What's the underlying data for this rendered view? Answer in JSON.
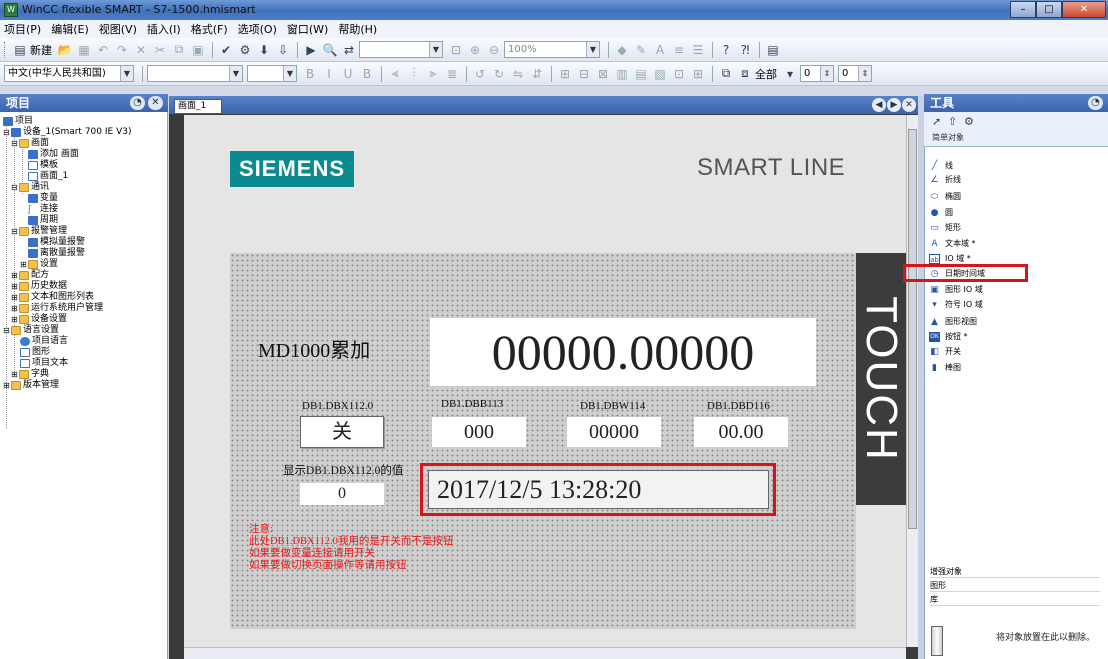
{
  "window": {
    "title": "WinCC flexible SMART - S7-1500.hmismart",
    "minimize": "–",
    "maximize": "□",
    "close": "✕"
  },
  "menu": [
    "项目(P)",
    "编辑(E)",
    "视图(V)",
    "插入(I)",
    "格式(F)",
    "选项(O)",
    "窗口(W)",
    "帮助(H)"
  ],
  "toolbar": {
    "new_label": "新建",
    "zoom_value": "100%",
    "all_label": "全部",
    "spin1": "0",
    "spin2": "0"
  },
  "language_combo": "中文(中华人民共和国)",
  "project_pane": {
    "title": "项目",
    "tree": [
      {
        "label": "项目",
        "level": 0
      },
      {
        "label": "设备_1(Smart 700 IE V3)",
        "level": 1
      },
      {
        "label": "画面",
        "level": 2
      },
      {
        "label": "添加 画面",
        "level": 3
      },
      {
        "label": "模板",
        "level": 3
      },
      {
        "label": "画面_1",
        "level": 3
      },
      {
        "label": "通讯",
        "level": 2
      },
      {
        "label": "变量",
        "level": 3
      },
      {
        "label": "连接",
        "level": 3
      },
      {
        "label": "周期",
        "level": 3
      },
      {
        "label": "报警管理",
        "level": 2
      },
      {
        "label": "模拟量报警",
        "level": 3
      },
      {
        "label": "离散量报警",
        "level": 3
      },
      {
        "label": "设置",
        "level": 3
      },
      {
        "label": "配方",
        "level": 2
      },
      {
        "label": "历史数据",
        "level": 2
      },
      {
        "label": "文本和图形列表",
        "level": 2
      },
      {
        "label": "运行系统用户管理",
        "level": 2
      },
      {
        "label": "设备设置",
        "level": 2
      },
      {
        "label": "语言设置",
        "level": 1
      },
      {
        "label": "项目语言",
        "level": 2
      },
      {
        "label": "图形",
        "level": 2
      },
      {
        "label": "项目文本",
        "level": 2
      },
      {
        "label": "字典",
        "level": 2
      },
      {
        "label": "版本管理",
        "level": 1
      }
    ]
  },
  "editor": {
    "tab": "画面_1",
    "logo": "SIEMENS",
    "brand_line": "SMART LINE",
    "touch": "TOUCH",
    "md_label": "MD1000累加",
    "md_value": "00000.00000",
    "fields": [
      {
        "label": "DB1.DBX112.0",
        "value": "关"
      },
      {
        "label": "DB1.DBB113",
        "value": "000"
      },
      {
        "label": "DB1.DBW114",
        "value": "00000"
      },
      {
        "label": "DB1.DBD116",
        "value": "00.00"
      }
    ],
    "show_label": "显示DB1.DBX112.0的值",
    "show_value": "0",
    "datetime": "2017/12/5 13:28:20",
    "notes": [
      "注意:",
      "此处DB1.DBX112.0我用的是开关而不是按钮",
      "如果要做变量连接请用开关",
      "如果要做切换页面操作等请用按钮"
    ]
  },
  "tools_pane": {
    "title": "工具",
    "section": "简单对象",
    "items": [
      {
        "label": "线",
        "icon": "line-icon",
        "glyph": "╱"
      },
      {
        "label": "折线",
        "icon": "polyline-icon",
        "glyph": "∠"
      },
      {
        "label": "椭圆",
        "icon": "ellipse-icon",
        "glyph": "⬭"
      },
      {
        "label": "圆",
        "icon": "circle-icon",
        "glyph": "●"
      },
      {
        "label": "矩形",
        "icon": "rectangle-icon",
        "glyph": "▭"
      },
      {
        "label": "文本域 *",
        "icon": "text-field-icon",
        "glyph": "A"
      },
      {
        "label": "IO 域 *",
        "icon": "io-field-icon",
        "glyph": "ab"
      },
      {
        "label": "日期时间域",
        "icon": "datetime-field-icon",
        "glyph": "◷"
      },
      {
        "label": "图形 IO 域",
        "icon": "graphic-io-icon",
        "glyph": "▣"
      },
      {
        "label": "符号 IO 域",
        "icon": "symbolic-io-icon",
        "glyph": "▾"
      },
      {
        "label": "图形视图",
        "icon": "graphic-view-icon",
        "glyph": "▲"
      },
      {
        "label": "按钮 *",
        "icon": "button-icon",
        "glyph": "OK"
      },
      {
        "label": "开关",
        "icon": "switch-icon",
        "glyph": "◧"
      },
      {
        "label": "棒图",
        "icon": "bar-icon",
        "glyph": "▮"
      }
    ],
    "bottom_sections": [
      "增强对象",
      "图形",
      "库"
    ],
    "drop_hint": "将对象放置在此以删除。"
  }
}
